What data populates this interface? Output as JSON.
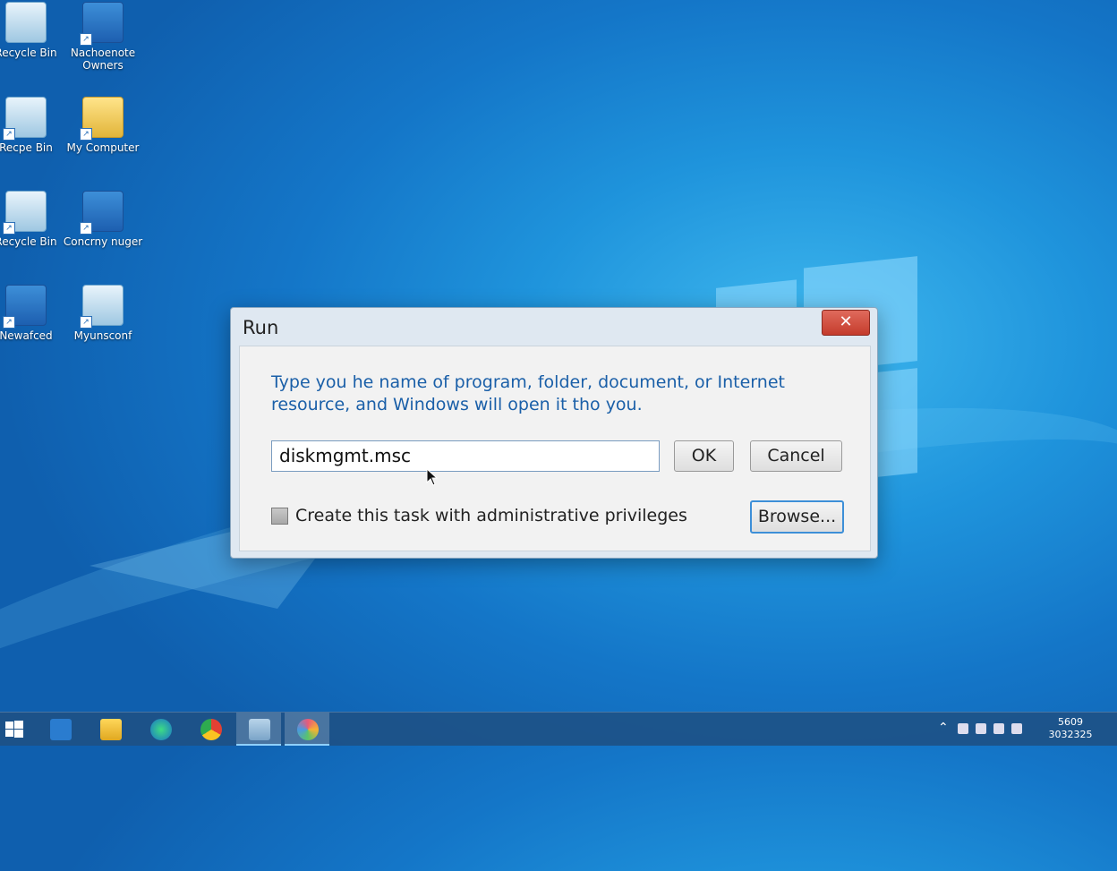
{
  "desktop": {
    "icons": [
      {
        "label": "Recycle Bin"
      },
      {
        "label": "Nachoenote Owners"
      },
      {
        "label": "Recpe Bin"
      },
      {
        "label": "My Computer"
      },
      {
        "label": "Recycle Bin"
      },
      {
        "label": "Concrny nuger"
      },
      {
        "label": "Newafced"
      },
      {
        "label": "Myunsconf"
      }
    ]
  },
  "dialog": {
    "title": "Run",
    "close_label": "✕",
    "description": "Type you he name of program, folder, document, or Internet resource, and Windows will open it tho you.",
    "input_value": "diskmgmt.msc",
    "ok_label": "OK",
    "cancel_label": "Cancel",
    "browse_label": "Browse...",
    "checkbox_label": "Create this task with administrative privileges",
    "checkbox_checked": false
  },
  "taskbar": {
    "clock_time": "5609",
    "clock_date": "3032325",
    "items": [
      "start-icon",
      "search-icon",
      "file-explorer-icon",
      "edge-icon",
      "chrome-icon",
      "folder-icon",
      "paint-icon"
    ]
  },
  "colors": {
    "accent": "#1a5fa8",
    "close": "#c43c2c"
  }
}
